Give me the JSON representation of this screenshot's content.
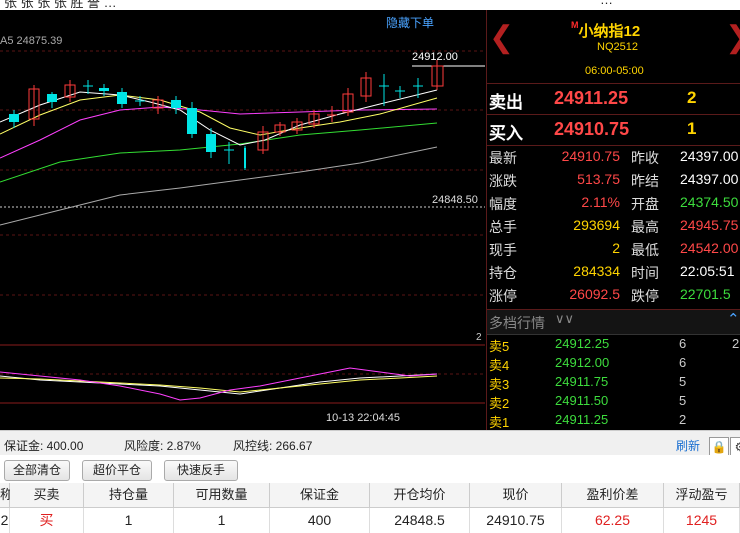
{
  "top_strip": {
    "left_fragment": "张 张 张 张 胜 誉 …",
    "right_fragment": "…"
  },
  "chart": {
    "hide_order_label": "隐藏下单",
    "ma_label": "A5 24875.39",
    "high_label": "24912.00",
    "ref_price_label": "24848.50",
    "sub_chart_label": "2",
    "cursor_time": "10-13 22:04:45",
    "colors": {
      "up": "#ff3b3b",
      "down": "#00e5e5",
      "ma5": "#ffffff",
      "ma10": "#ffff66",
      "ma20": "#ff40ff",
      "ma40": "#33dd33",
      "ma60": "#aaaaaa"
    }
  },
  "quote": {
    "title_marker": "M",
    "title": "小纳指12",
    "code": "NQ2512",
    "session": "06:00-05:00",
    "sell_label": "卖出",
    "sell_price": "24911.25",
    "sell_qty": "2",
    "buy_label": "买入",
    "buy_price": "24910.75",
    "buy_qty": "1",
    "rows": [
      {
        "l1": "最新",
        "v1": "24910.75",
        "c1": "#ff4848",
        "l2": "昨收",
        "v2": "24397.00",
        "c2": "#ffffff"
      },
      {
        "l1": "涨跌",
        "v1": "513.75",
        "c1": "#ff4848",
        "l2": "昨结",
        "v2": "24397.00",
        "c2": "#ffffff"
      },
      {
        "l1": "幅度",
        "v1": "2.11%",
        "c1": "#ff4848",
        "l2": "开盘",
        "v2": "24374.50",
        "c2": "#3ddc3d"
      },
      {
        "l1": "总手",
        "v1": "293694",
        "c1": "#ffd400",
        "l2": "最高",
        "v2": "24945.75",
        "c2": "#ff4848"
      },
      {
        "l1": "现手",
        "v1": "2",
        "c1": "#ffd400",
        "l2": "最低",
        "v2": "24542.00",
        "c2": "#ff4848"
      },
      {
        "l1": "持仓",
        "v1": "284334",
        "c1": "#ffd400",
        "l2": "时间",
        "v2": "22:05:51",
        "c2": "#ffffff"
      },
      {
        "l1": "涨停",
        "v1": "26092.5",
        "c1": "#ff4848",
        "l2": "跌停",
        "v2": "22701.5",
        "c2": "#3ddc3d"
      }
    ],
    "depth_title": "多档行情",
    "depth": [
      {
        "label": "卖5",
        "price": "24912.25",
        "qty": "6",
        "extra": "2"
      },
      {
        "label": "卖4",
        "price": "24912.00",
        "qty": "6",
        "extra": ""
      },
      {
        "label": "卖3",
        "price": "24911.75",
        "qty": "5",
        "extra": ""
      },
      {
        "label": "卖2",
        "price": "24911.50",
        "qty": "5",
        "extra": ""
      },
      {
        "label": "卖1",
        "price": "24911.25",
        "qty": "2",
        "extra": ""
      }
    ]
  },
  "account": {
    "margin": "保证金: 400.00",
    "risk": "风险度: 2.87%",
    "risk_line": "风控线: 266.67",
    "refresh": "刷新"
  },
  "buttons": {
    "close_all": "全部清仓",
    "market_close": "超价平仓",
    "quick_reverse": "快速反手"
  },
  "positions": {
    "headers": [
      "称",
      "买卖",
      "持仓量",
      "可用数量",
      "保证金",
      "开仓均价",
      "现价",
      "盈利价差",
      "浮动盈亏"
    ],
    "rows": [
      [
        "2",
        "买",
        "1",
        "1",
        "400",
        "24848.5",
        "24910.75",
        "62.25",
        "1245"
      ]
    ]
  }
}
